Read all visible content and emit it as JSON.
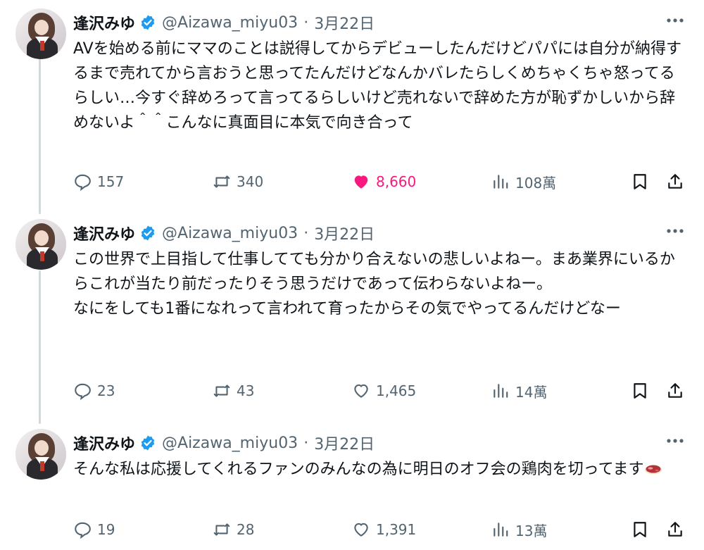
{
  "colors": {
    "text": "#0f1419",
    "muted": "#536471",
    "verified": "#1d9bf0",
    "like_active": "#f91880",
    "thread_line": "#cfd9de"
  },
  "tweets": [
    {
      "name": "逢沢みゆ",
      "handle": "@Aizawa_miyu03",
      "sep": "·",
      "date": "3月22日",
      "text": "AVを始める前にママのことは説得してからデビューしたんだけどパパには自分が納得するまで売れてから言おうと思ってたんだけどなんかバレたらしくめちゃくちゃ怒ってるらしい…今すぐ辞めろって言ってるらしいけど売れないで辞めた方が恥ずかしいから辞めないよ＾＾こんなに真面目に本気で向き合って",
      "replies": "157",
      "retweets": "340",
      "likes": "8,660",
      "liked": true,
      "views": "108萬"
    },
    {
      "name": "逢沢みゆ",
      "handle": "@Aizawa_miyu03",
      "sep": "·",
      "date": "3月22日",
      "text": "この世界で上目指して仕事してても分かり合えないの悲しいよねー。まあ業界にいるからこれが当たり前だったりそう思うだけであって伝わらないよねー。\nなにをしても1番になれって言われて育ったからその気でやってるんだけどなー",
      "replies": "23",
      "retweets": "43",
      "likes": "1,465",
      "liked": false,
      "views": "14萬"
    },
    {
      "name": "逢沢みゆ",
      "handle": "@Aizawa_miyu03",
      "sep": "·",
      "date": "3月22日",
      "text": "そんな私は応援してくれるファンのみんなの為に明日のオフ会の鶏肉を切ってます",
      "emoji_icon": "steak-icon",
      "replies": "19",
      "retweets": "28",
      "likes": "1,391",
      "liked": false,
      "views": "13萬"
    }
  ]
}
